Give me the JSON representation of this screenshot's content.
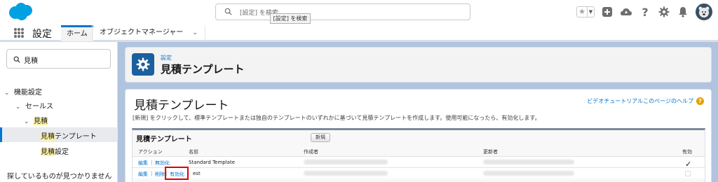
{
  "header": {
    "search_placeholder": "[設定] を検索",
    "tooltip": "[設定] を検索"
  },
  "nav": {
    "app_name": "設定",
    "tabs": [
      {
        "label": "ホーム"
      },
      {
        "label": "オブジェクトマネージャー"
      }
    ]
  },
  "sidebar": {
    "quick_find_value": "見積",
    "tree": {
      "features": "機能設定",
      "sales": "セールス",
      "quote": "見積",
      "quote_templates_prefix": "見積",
      "quote_templates_suffix": "テンプレート",
      "quote_settings_prefix": "見積",
      "quote_settings_suffix": "設定"
    },
    "help_question": "探しているものが見つかりませんか?"
  },
  "page_header": {
    "breadcrumb": "設定",
    "title": "見積テンプレート"
  },
  "content": {
    "title": "見積テンプレート",
    "help_link": "ビデオチュートリアルこのページのヘルプ",
    "help_icon": "?",
    "description": "[新規] をクリックして、標準テンプレートまたは独自のテンプレートのいずれかに基づいて見積テンプレートを作成します。使用可能になったら、有効化します。",
    "table": {
      "title": "見積テンプレート",
      "new_button": "新規",
      "columns": {
        "action": "アクション",
        "name": "名前",
        "created_by": "作成者",
        "modified_by": "更新者",
        "active": "有効"
      },
      "rows": [
        {
          "edit": "編集",
          "sep": "|",
          "action2": "無効化",
          "name": "Standard Template",
          "active": true,
          "active_mark": "✓"
        },
        {
          "edit": "編集",
          "sep": "|",
          "action2": "削除",
          "sep2": "|",
          "action3": "有効化",
          "name": "est",
          "active": false
        }
      ]
    }
  },
  "colors": {
    "accent": "#0176d3",
    "highlight": "#fff3a8",
    "annotation_red": "#e00000",
    "main_background": "#b0c4df"
  },
  "icons": [
    "salesforce-cloud-logo",
    "search-icon",
    "star-icon",
    "plus-icon",
    "trailhead-icon",
    "help-icon",
    "gear-icon",
    "bell-icon",
    "avatar",
    "app-launcher-icon",
    "chevron-down-icon"
  ]
}
